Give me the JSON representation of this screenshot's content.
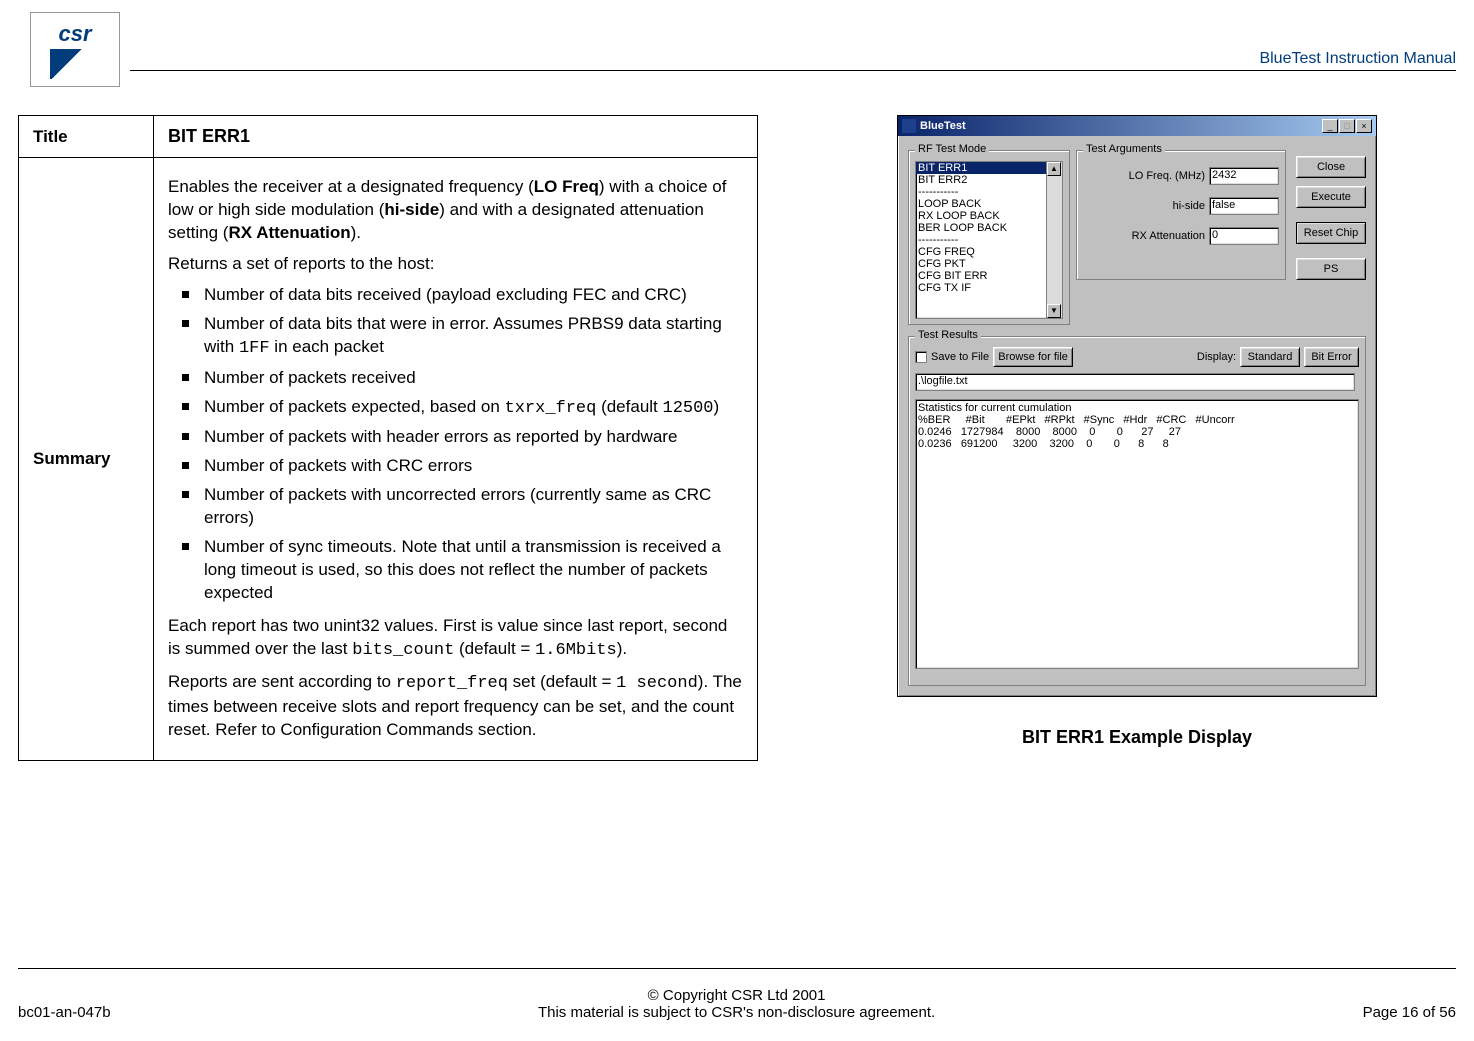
{
  "header": {
    "logo_text": "csr",
    "doc_title": "BlueTest Instruction Manual"
  },
  "table": {
    "title_label": "Title",
    "title_value": "BIT ERR1",
    "summary_label": "Summary",
    "intro": "Enables the receiver at a designated frequency (LO Freq) with a choice of low or high side modulation (hi-side) and with a designated attenuation setting  (RX Attenuation).",
    "returns": "Returns a set of reports to the host:",
    "bullets": [
      "Number of data bits received (payload excluding FEC and CRC)",
      "Number of data bits that were in error. Assumes PRBS9 data starting with 1FF in each packet",
      "Number of packets received",
      "Number of packets expected, based on txrx_freq (default 12500)",
      "Number of packets with header errors as reported by hardware",
      "Number of packets with CRC errors",
      "Number of packets with uncorrected errors (currently same as CRC errors)",
      "Number of sync timeouts. Note that until a transmission is received a long timeout is used, so this does not reflect the number of packets expected"
    ],
    "para2": "Each report has two unint32 values. First is value since last report, second is summed over the last bits_count (default = 1.6Mbits).",
    "para3": "Reports are sent according to report_freq set (default = 1 second). The times between receive slots and report frequency can be set, and the count reset. Refer to Configuration Commands section."
  },
  "app": {
    "title": "BlueTest",
    "groups": {
      "rf_mode": "RF Test Mode",
      "args": "Test Arguments",
      "results": "Test Results"
    },
    "listbox": [
      "BIT ERR1",
      "BIT ERR2",
      "-----------",
      "LOOP BACK",
      "RX LOOP BACK",
      "BER LOOP BACK",
      "-----------",
      "CFG FREQ",
      "CFG PKT",
      "CFG BIT ERR",
      "CFG TX IF"
    ],
    "listbox_selected": 0,
    "args": {
      "lo_freq_label": "LO Freq. (MHz)",
      "lo_freq_value": "2432",
      "hi_side_label": "hi-side",
      "hi_side_value": "false",
      "rx_att_label": "RX Attenuation",
      "rx_att_value": "0"
    },
    "buttons": {
      "close": "Close",
      "execute": "Execute",
      "reset_chip": "Reset Chip",
      "ps": "PS"
    },
    "results": {
      "save_label": "Save to File",
      "browse": "Browse for file",
      "display_label": "Display:",
      "standard": "Standard",
      "bit_error": "Bit Error",
      "path": ".\\logfile.txt",
      "stats_header": "Statistics for current cumulation",
      "columns": [
        "%BER",
        "#Bit",
        "#EPkt",
        "#RPkt",
        "#Sync",
        "#Hdr",
        "#CRC",
        "#Uncorr"
      ],
      "rows": [
        [
          "0.0246",
          "1727984",
          "8000",
          "8000",
          "0",
          "0",
          "27",
          "27"
        ],
        [
          "0.0236",
          "691200",
          "3200",
          "3200",
          "0",
          "0",
          "8",
          "8"
        ]
      ]
    }
  },
  "caption": "BIT ERR1 Example Display",
  "footer": {
    "left": "bc01-an-047b",
    "center1": "© Copyright CSR Ltd 2001",
    "center2": "This material is subject to CSR's non-disclosure agreement.",
    "right": "Page 16 of 56"
  }
}
